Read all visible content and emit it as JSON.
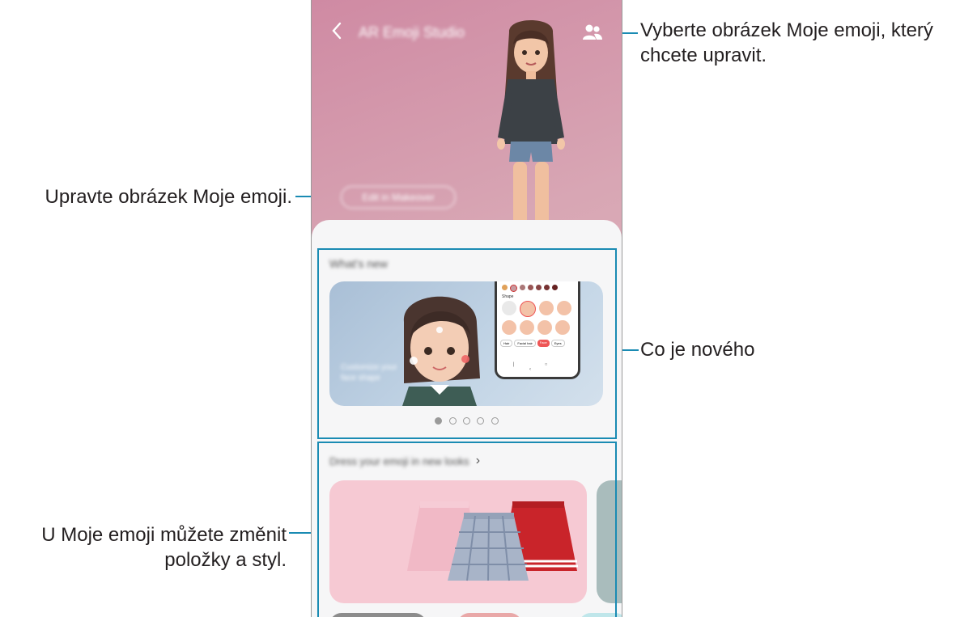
{
  "annotations": {
    "select_emoji": "Vyberte obrázek Moje emoji, který chcete upravit.",
    "edit_emoji": "Upravte obrázek Moje emoji.",
    "whats_new": "Co je nového",
    "change_items": "U Moje emoji můžete změnit položky a styl."
  },
  "app": {
    "title": "AR Emoji Studio",
    "edit_button": "Edit in Makeover",
    "whats_new_heading": "What's new",
    "dress_heading": "Dress your emoji in new looks",
    "carousel_pages": 5,
    "carousel_current": 1,
    "promo_text": "Customize your face shape"
  },
  "phone_ui": {
    "tabs": [
      "Hair",
      "Facial hair",
      "Face",
      "Eyes"
    ],
    "shape_label": "Shape"
  },
  "colors": {
    "accent_line": "#1a8bb3",
    "header_gradient_start": "#cf8aa3",
    "header_gradient_end": "#e6c1c2",
    "skirts_card_bg": "#f6c9d3"
  }
}
